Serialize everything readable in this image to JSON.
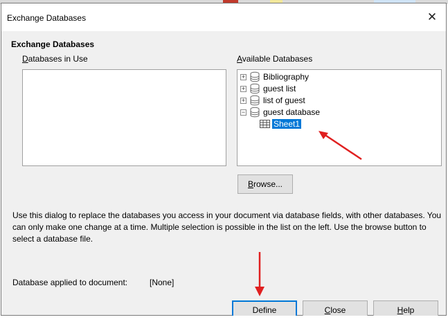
{
  "window": {
    "title": "Exchange Databases",
    "close_glyph": "✕"
  },
  "section_title": "Exchange Databases",
  "databases_in_use": {
    "label_prefix": "",
    "label_accel": "D",
    "label_rest": "atabases in Use",
    "items": []
  },
  "available": {
    "label_accel": "A",
    "label_rest": "vailable Databases",
    "items": [
      {
        "label": "Bibliography",
        "expanded": false
      },
      {
        "label": "guest list",
        "expanded": false
      },
      {
        "label": "list of guest",
        "expanded": false
      },
      {
        "label": "guest database",
        "expanded": true,
        "children": [
          {
            "label": "Sheet1",
            "selected": true
          }
        ]
      }
    ]
  },
  "buttons": {
    "browse": {
      "accel": "B",
      "rest": "rowse..."
    },
    "define": {
      "accel": "",
      "rest": "Define"
    },
    "close": {
      "accel": "C",
      "rest": "lose"
    },
    "help": {
      "accel": "H",
      "rest": "elp"
    }
  },
  "description": "Use this dialog to replace the databases you access in your document via database fields, with other databases. You can only make one change at a time. Multiple selection is possible in the list on the left. Use the browse button to select a database file.",
  "applied": {
    "label": "Database applied to document:",
    "value": "[None]"
  },
  "colors": {
    "selection": "#0078d7",
    "arrow": "#e02020"
  },
  "icons": {
    "close": "close-icon",
    "expand": "expand-plus-icon",
    "collapse": "collapse-minus-icon",
    "database": "database-icon",
    "table": "table-icon"
  }
}
